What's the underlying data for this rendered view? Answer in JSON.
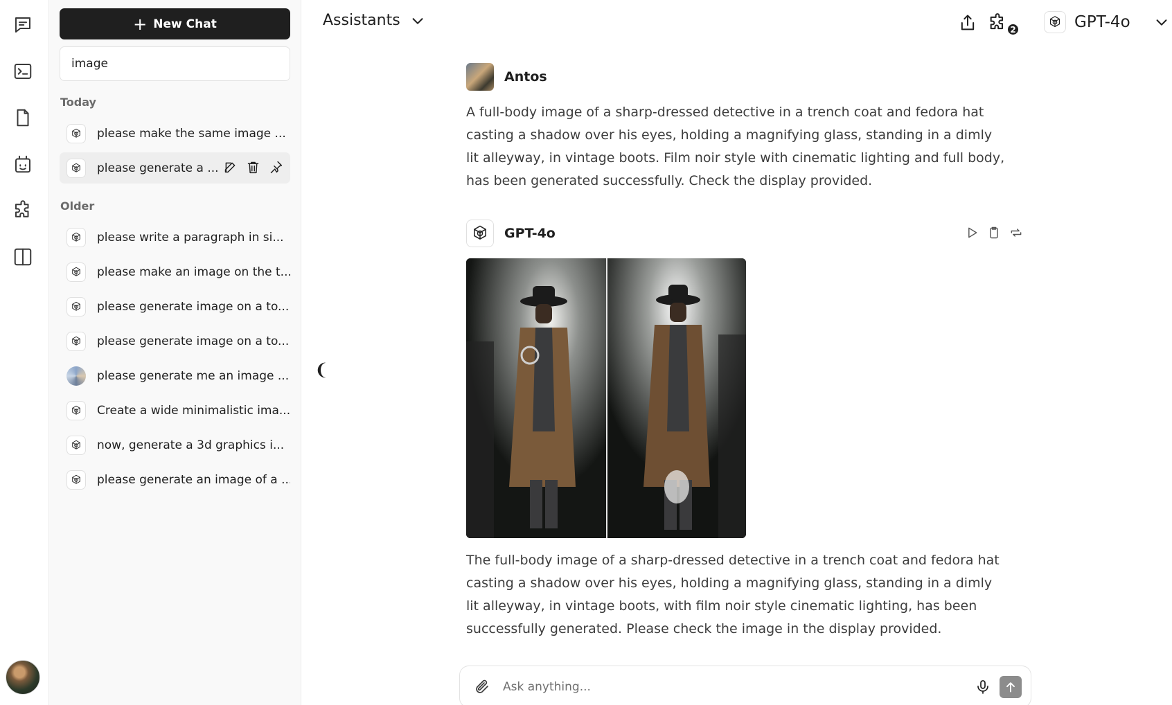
{
  "rail": {
    "items": [
      {
        "icon": "chat-icon"
      },
      {
        "icon": "terminal-icon"
      },
      {
        "icon": "file-icon"
      },
      {
        "icon": "bot-icon"
      },
      {
        "icon": "puzzle-icon"
      },
      {
        "icon": "split-panel-icon"
      }
    ]
  },
  "sidebar": {
    "new_chat_label": "New Chat",
    "search_value": "image",
    "today_label": "Today",
    "older_label": "Older",
    "today": [
      {
        "label": "please make the same image ...",
        "icon": "openai-icon"
      },
      {
        "label": "please generate a ...",
        "icon": "openai-icon",
        "active": true
      }
    ],
    "older": [
      {
        "label": "please write a paragraph in si...",
        "icon": "openai-icon"
      },
      {
        "label": "please make an image on the t...",
        "icon": "openai-icon"
      },
      {
        "label": "please generate image on a to...",
        "icon": "openai-icon"
      },
      {
        "label": "please generate image on a to...",
        "icon": "openai-icon"
      },
      {
        "label": "please generate me an image ...",
        "icon": "image-thumb-icon"
      },
      {
        "label": "Create a wide minimalistic ima...",
        "icon": "openai-icon"
      },
      {
        "label": "now, generate a 3d graphics i...",
        "icon": "openai-icon"
      },
      {
        "label": "please generate an image of a ...",
        "icon": "openai-icon"
      }
    ]
  },
  "header": {
    "title": "Assistants",
    "plugin_badge": "2",
    "model": "GPT-4o"
  },
  "collapse_glyph": "❨",
  "messages": [
    {
      "author": "Antos",
      "text": "A full-body image of a sharp-dressed detective in a trench coat and fedora hat casting a shadow over his eyes, holding a magnifying glass, standing in a dimly lit alleyway, in vintage boots. Film noir style with cinematic lighting and full body, has been generated successfully. Check the display provided."
    },
    {
      "author": "GPT-4o",
      "text": "The full-body image of a sharp-dressed detective in a trench coat and fedora hat casting a shadow over his eyes, holding a magnifying glass, standing in a dimly lit alleyway, in vintage boots, with film noir style cinematic lighting, has been successfully generated. Please check the image in the display provided."
    }
  ],
  "composer": {
    "placeholder": "Ask anything..."
  },
  "colors": {
    "primary_button": "#1f1f1f",
    "sidebar_bg": "#f9f9f9",
    "send_button": "#8c8c8c"
  }
}
